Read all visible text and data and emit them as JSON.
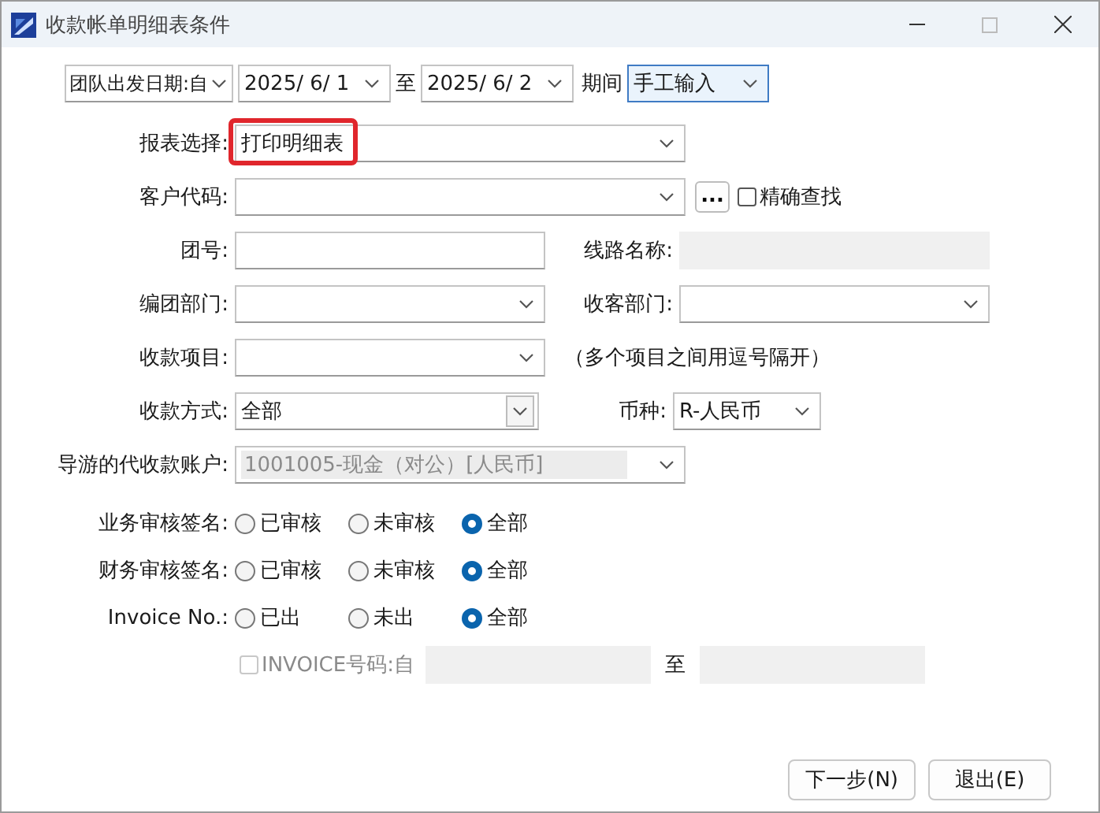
{
  "window": {
    "title": "收款帐单明细表条件"
  },
  "date_range": {
    "type": "团队出发日期:自",
    "from": "2025/  6/  1",
    "separator": "至",
    "to": "2025/  6/  2",
    "period_label": "期间",
    "period": "手工输入",
    "period_focused": true
  },
  "rows": [
    {
      "fields": [
        {
          "label": "报表选择:",
          "kind": "combo",
          "value": "打印明细表",
          "highlighted": true
        }
      ]
    },
    {
      "fields": [
        {
          "label": "客户代码:",
          "kind": "combo"
        }
      ],
      "browse_button": "...",
      "exact_search": {
        "label": "精确查找",
        "checked": false
      }
    },
    {
      "fields": [
        {
          "label": "团号:",
          "kind": "text"
        },
        {
          "label": "线路名称:",
          "kind": "readonly"
        }
      ]
    },
    {
      "fields": [
        {
          "label": "编团部门:",
          "kind": "combo"
        },
        {
          "label": "收客部门:",
          "kind": "combo"
        }
      ]
    },
    {
      "fields": [
        {
          "label": "收款项目:",
          "kind": "combo"
        }
      ],
      "note": "（多个项目之间用逗号隔开）"
    },
    {
      "fields": [
        {
          "label": "收款方式:",
          "kind": "listbox",
          "value": "全部"
        },
        {
          "label": "币种:",
          "kind": "combo",
          "value": "R-人民币"
        }
      ]
    },
    {
      "fields": [
        {
          "label": "导游的代收款账户:",
          "kind": "combo",
          "value": "1001005-现金（对公）[人民币]",
          "disabled": true
        }
      ]
    }
  ],
  "radio_groups": [
    {
      "label": "业务审核签名:",
      "options": [
        {
          "label": "已审核",
          "selected": false
        },
        {
          "label": "未审核",
          "selected": false
        },
        {
          "label": "全部",
          "selected": true
        }
      ]
    },
    {
      "label": "财务审核签名:",
      "options": [
        {
          "label": "已审核",
          "selected": false
        },
        {
          "label": "未审核",
          "selected": false
        },
        {
          "label": "全部",
          "selected": true
        }
      ]
    },
    {
      "label": "Invoice No.:",
      "options": [
        {
          "label": "已出",
          "selected": false
        },
        {
          "label": "未出",
          "selected": false
        },
        {
          "label": "全部",
          "selected": true
        }
      ]
    }
  ],
  "invoice_range": {
    "label": "INVOICE号码:自",
    "checked": false,
    "disabled": true,
    "separator": "至"
  },
  "buttons": [
    "下一步(N)",
    "退出(E)"
  ]
}
